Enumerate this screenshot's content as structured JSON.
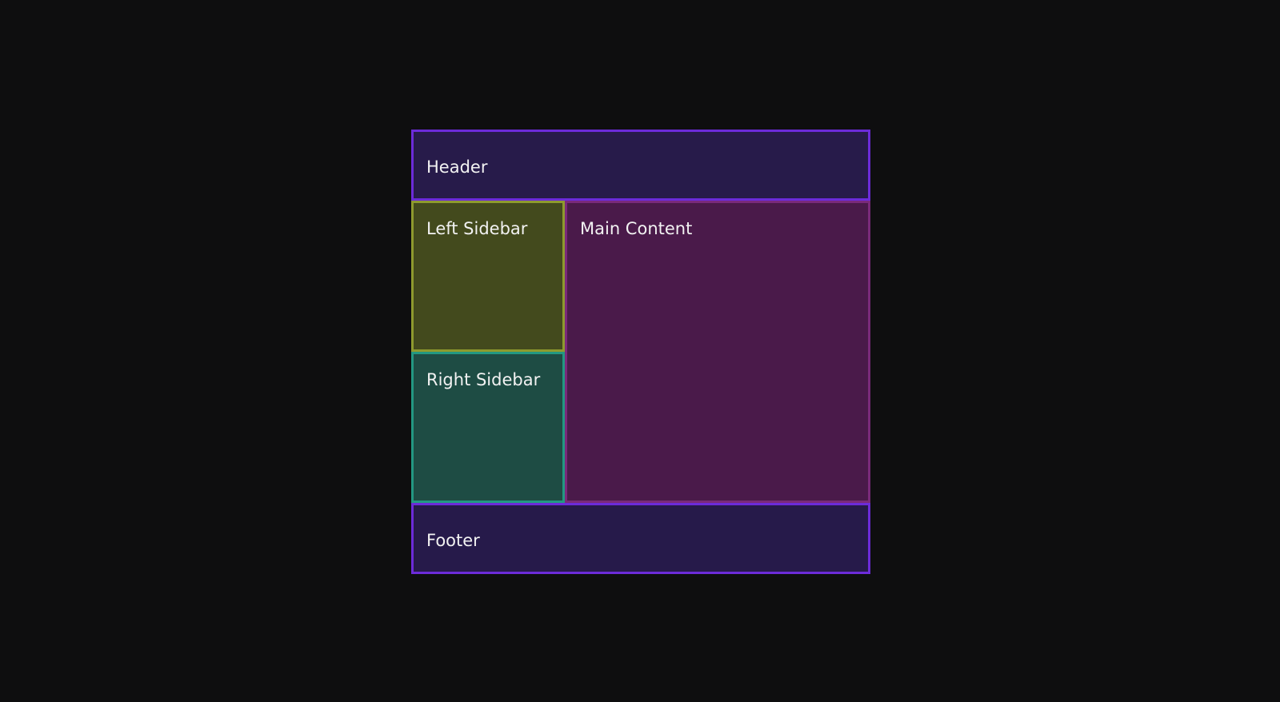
{
  "regions": {
    "header": {
      "label": "Header",
      "color": "#271b4a",
      "border": "#6c2bd9"
    },
    "left_sidebar": {
      "label": "Left Sidebar",
      "color": "#434a1d",
      "border": "#8e9a2e"
    },
    "right_sidebar": {
      "label": "Right Sidebar",
      "color": "#1e4c44",
      "border": "#239882"
    },
    "main_content": {
      "label": "Main Content",
      "color": "#4a1a4a",
      "border": "#7a2a7a"
    },
    "footer": {
      "label": "Footer",
      "color": "#261a4a",
      "border": "#6c2bd9"
    }
  }
}
